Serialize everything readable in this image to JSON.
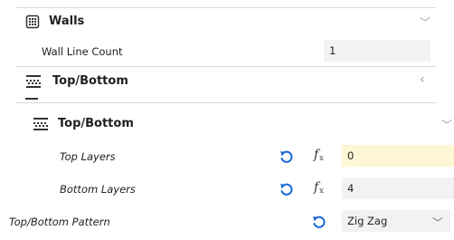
{
  "walls": {
    "title": "Walls",
    "icon": "walls-grid-icon",
    "setting_label": "Wall Line Count",
    "setting_value": "1"
  },
  "top_bottom_collapsed": {
    "title": "Top/Bottom",
    "icon": "top-bottom-icon"
  },
  "top_bottom_expanded": {
    "title": "Top/Bottom",
    "icon": "top-bottom-icon",
    "top_layers": {
      "label": "Top Layers",
      "value": "0"
    },
    "bottom_layers": {
      "label": "Bottom Layers",
      "value": "4"
    },
    "pattern": {
      "label": "Top/Bottom Pattern",
      "value": "Zig Zag"
    }
  },
  "colors": {
    "accent_blue": "#1a67d8",
    "highlight_field": "#fff6d6",
    "field_bg": "#f2f2f2"
  }
}
